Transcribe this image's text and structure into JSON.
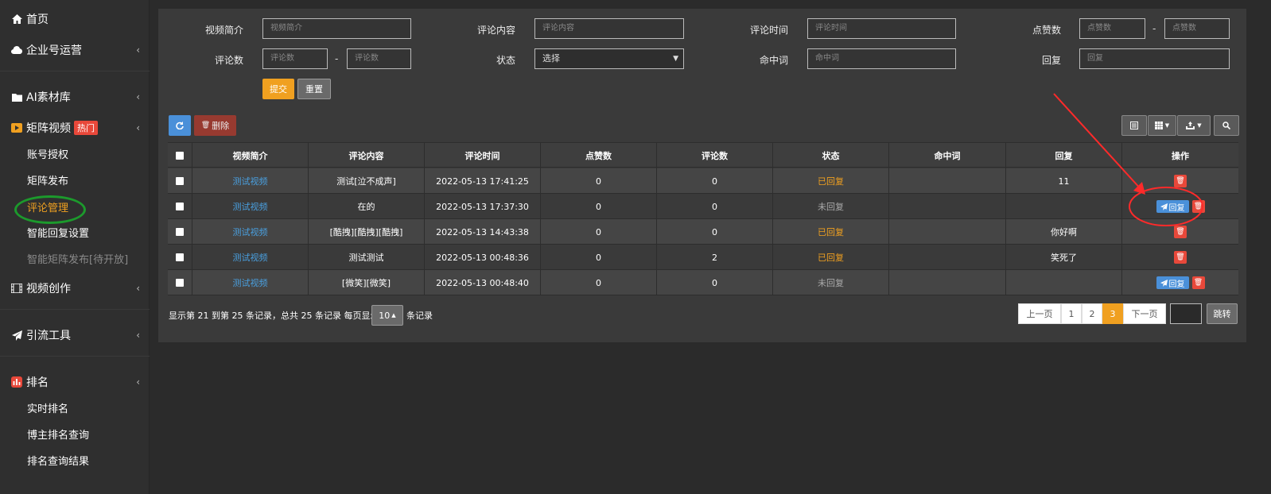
{
  "sidebar": {
    "home": "首页",
    "enterprise": "企业号运营",
    "ai_library": "AI素材库",
    "matrix_video": "矩阵视频",
    "hot_badge": "热门",
    "sub_matrix": [
      "账号授权",
      "矩阵发布",
      "评论管理",
      "智能回复设置",
      "智能矩阵发布[待开放]"
    ],
    "video_create": "视频创作",
    "traffic_tools": "引流工具",
    "ranking": "排名",
    "sub_ranking": [
      "实时排名",
      "博主排名查询",
      "排名查询结果"
    ]
  },
  "filters": {
    "video_intro_label": "视频简介",
    "video_intro_ph": "视频简介",
    "comment_content_label": "评论内容",
    "comment_content_ph": "评论内容",
    "comment_time_label": "评论时间",
    "comment_time_ph": "评论时间",
    "likes_label": "点赞数",
    "likes_min_ph": "点赞数",
    "likes_max_ph": "点赞数",
    "comments_label": "评论数",
    "comments_min_ph": "评论数",
    "comments_max_ph": "评论数",
    "status_label": "状态",
    "status_value": "选择",
    "hit_word_label": "命中词",
    "hit_word_ph": "命中词",
    "reply_label": "回复",
    "reply_ph": "回复",
    "range_sep": "-",
    "submit": "提交",
    "reset": "重置"
  },
  "toolbar": {
    "delete": "删除"
  },
  "table": {
    "headers": [
      "视频简介",
      "评论内容",
      "评论时间",
      "点赞数",
      "评论数",
      "状态",
      "命中词",
      "回复",
      "操作"
    ],
    "rows": [
      {
        "video": "测试视频",
        "content": "测试[泣不成声]",
        "time": "2022-05-13 17:41:25",
        "likes": "0",
        "comments": "0",
        "status": "已回复",
        "hit": "",
        "reply": "11",
        "has_reply_btn": false
      },
      {
        "video": "测试视频",
        "content": "在的",
        "time": "2022-05-13 17:37:30",
        "likes": "0",
        "comments": "0",
        "status": "未回复",
        "hit": "",
        "reply": "",
        "has_reply_btn": true
      },
      {
        "video": "测试视频",
        "content": "[酷拽][酷拽][酷拽]",
        "time": "2022-05-13 14:43:38",
        "likes": "0",
        "comments": "0",
        "status": "已回复",
        "hit": "",
        "reply": "你好啊",
        "has_reply_btn": false
      },
      {
        "video": "测试视频",
        "content": "测试测试",
        "time": "2022-05-13 00:48:36",
        "likes": "0",
        "comments": "2",
        "status": "已回复",
        "hit": "",
        "reply": "笑死了",
        "has_reply_btn": false
      },
      {
        "video": "测试视频",
        "content": "[微笑][微笑]",
        "time": "2022-05-13 00:48:40",
        "likes": "0",
        "comments": "0",
        "status": "未回复",
        "hit": "",
        "reply": "",
        "has_reply_btn": true
      }
    ],
    "reply_btn_label": "回复"
  },
  "footer": {
    "summary": "显示第 21 到第 25 条记录，总共 25 条记录 每页显示",
    "per_page": "10",
    "suffix": "条记录",
    "prev": "上一页",
    "pages": [
      "1",
      "2",
      "3"
    ],
    "current_page": "3",
    "next": "下一页",
    "jump": "跳转"
  },
  "colors": {
    "accent": "#f0a020",
    "link": "#4aa0e0",
    "danger": "#e8483a",
    "annotation_red": "#ff2a2a",
    "annotation_green": "#1c9a2c"
  }
}
